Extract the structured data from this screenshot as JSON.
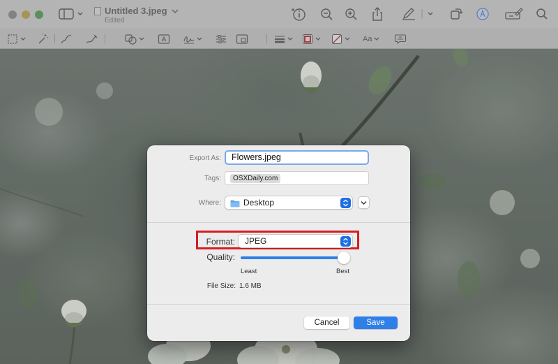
{
  "window": {
    "title": "Untitled 3.jpeg",
    "subtitle": "Edited"
  },
  "icons": {
    "sidebar": "sidebar-icon",
    "info": "info-icon",
    "zoom_out": "zoom-out-icon",
    "zoom_in": "zoom-in-icon",
    "share": "share-icon",
    "markup": "pen-icon",
    "rotate": "rotate-icon",
    "highlight": "highlight-icon",
    "signature": "signature-icon",
    "search": "search-icon"
  },
  "markup_toolbar": {
    "text_style_label": "Aa"
  },
  "dialog": {
    "export_as_label": "Export As:",
    "export_as_value": "Flowers.jpeg",
    "tags_label": "Tags:",
    "tag_value": "OSXDaily.com",
    "where_label": "Where:",
    "where_value": "Desktop",
    "format_label": "Format:",
    "format_value": "JPEG",
    "quality_label": "Quality:",
    "quality_min_label": "Least",
    "quality_max_label": "Best",
    "quality_level": 1.0,
    "file_size_label": "File Size:",
    "file_size_value": "1.6 MB",
    "cancel_label": "Cancel",
    "save_label": "Save"
  },
  "colors": {
    "accent": "#2f7fe9",
    "highlight_box": "#d61d22"
  }
}
